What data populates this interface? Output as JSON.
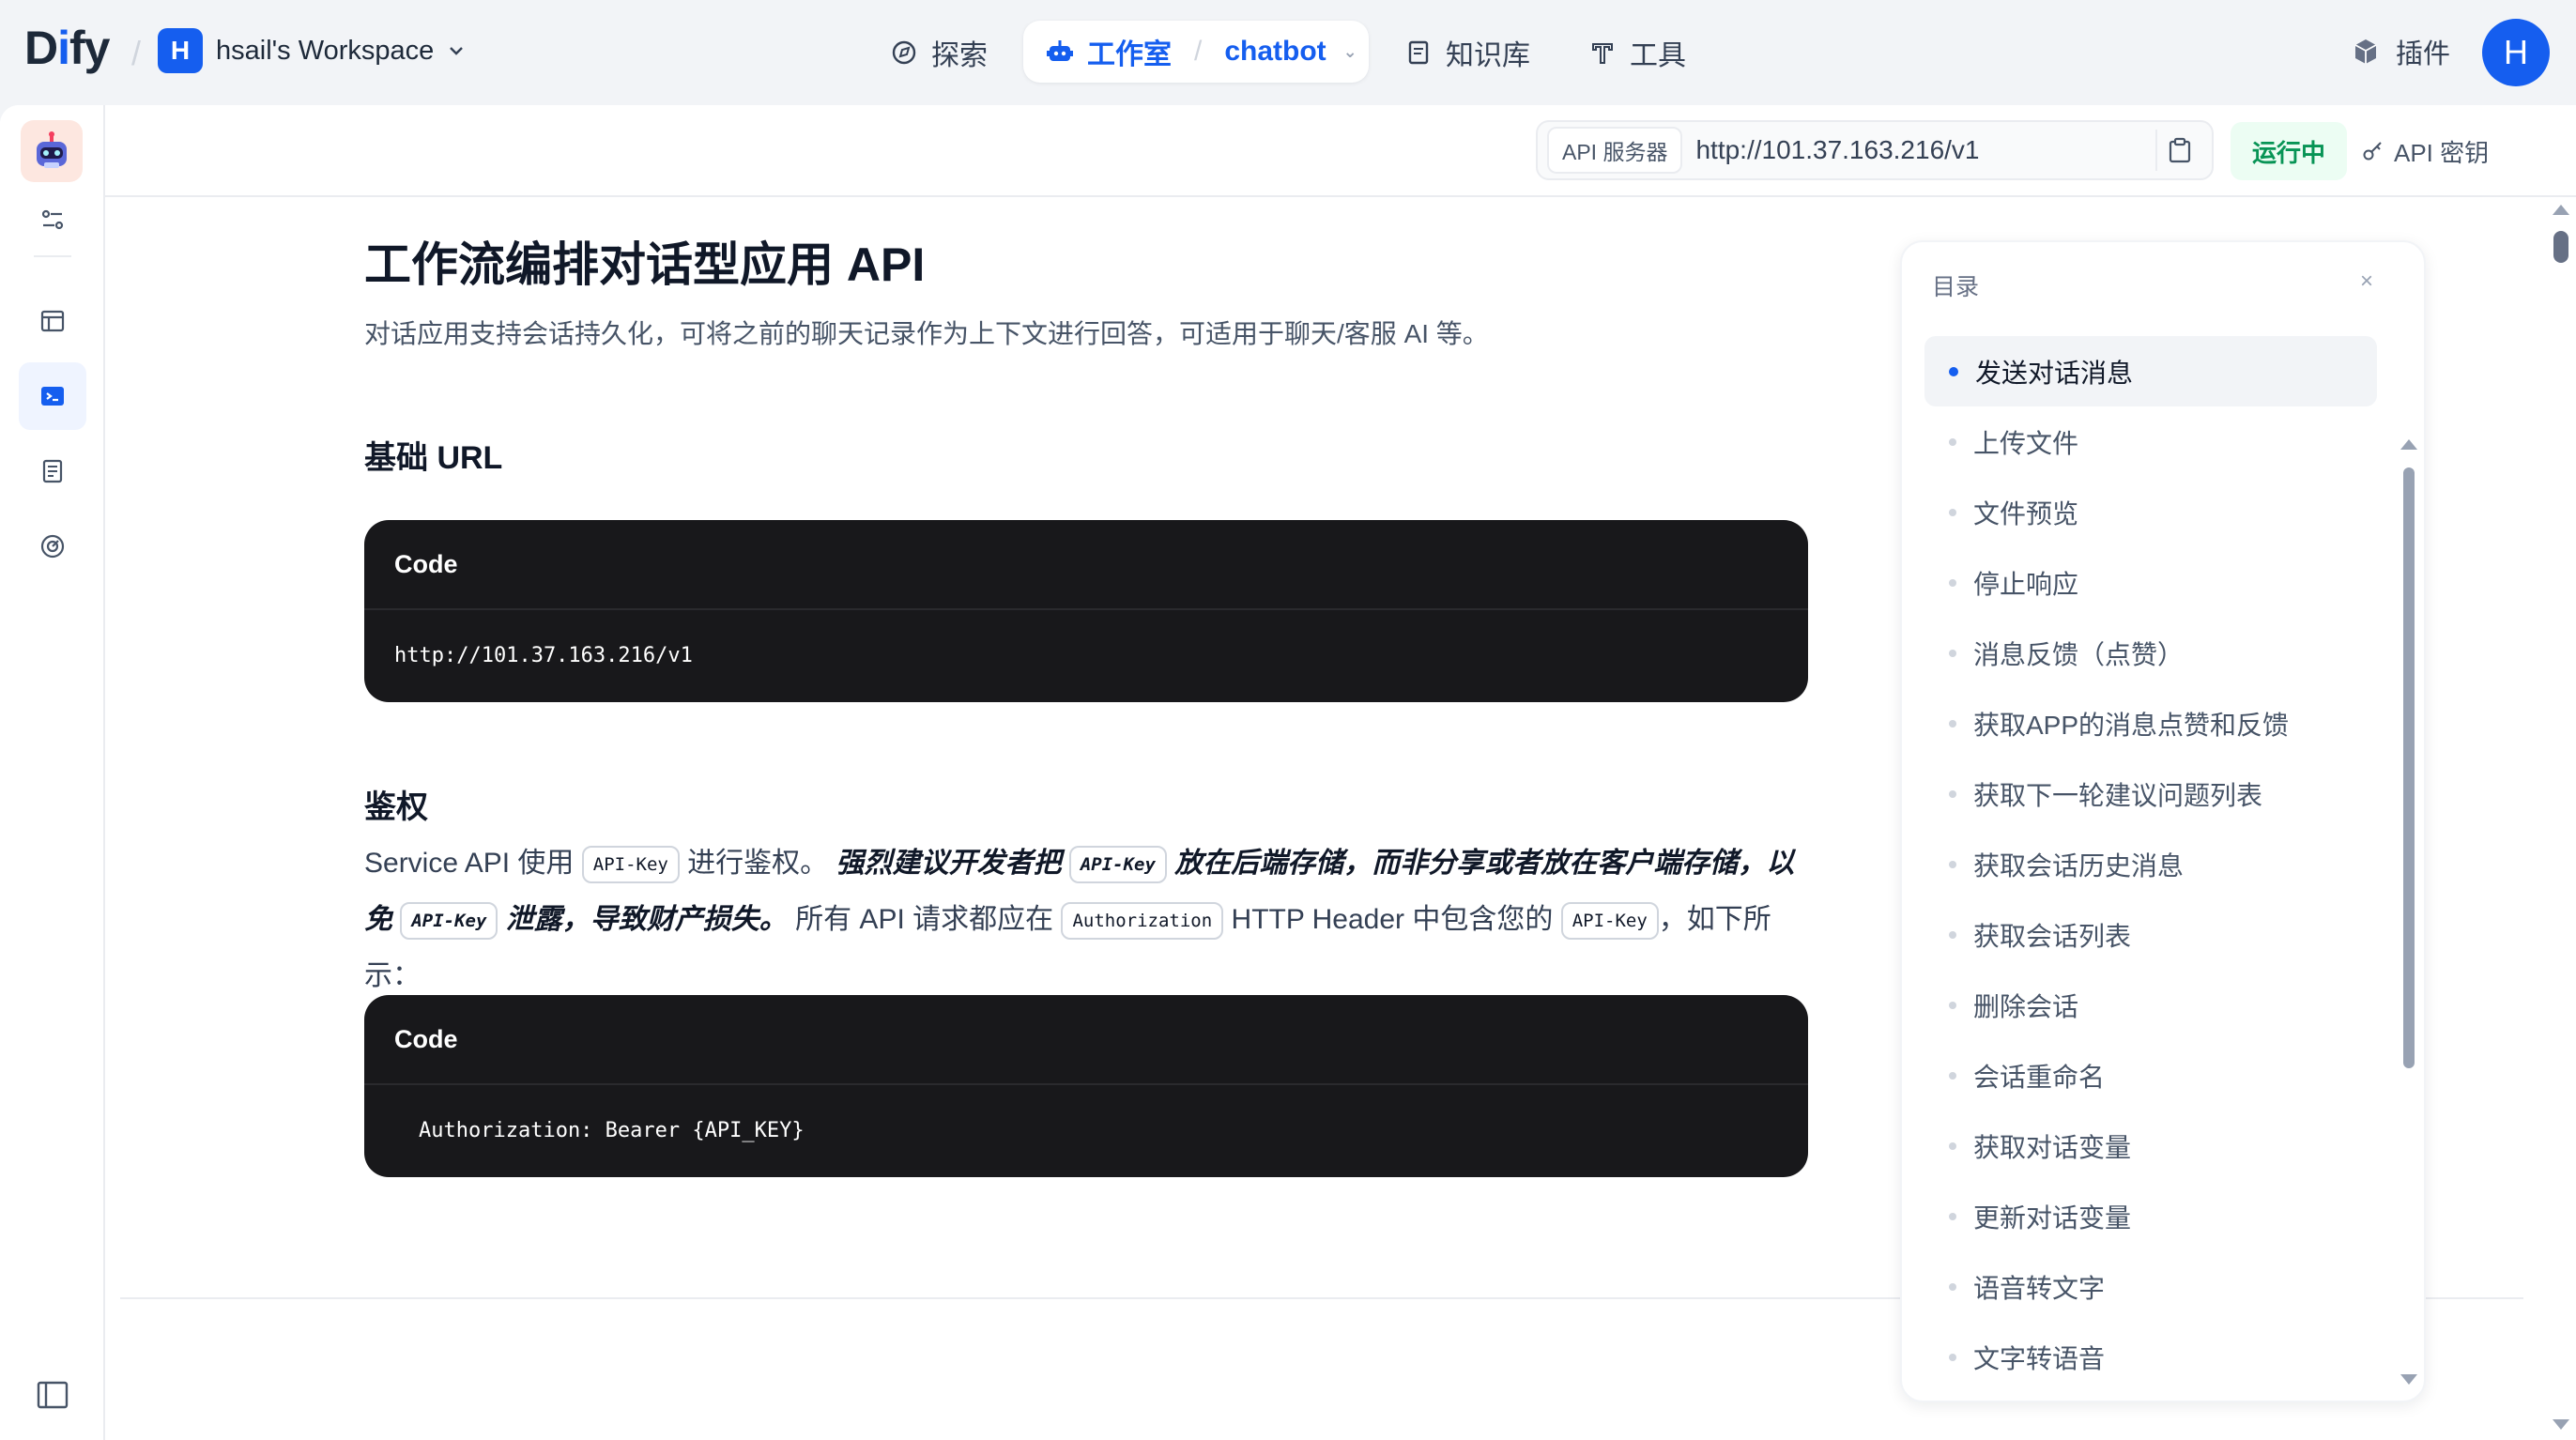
{
  "topbar": {
    "logo_prefix": "D",
    "logo_i": "i",
    "logo_suffix": "fy",
    "workspace_initial": "H",
    "workspace_name": "hsail's Workspace",
    "nav": {
      "explore": "探索",
      "studio": "工作室",
      "app_name": "chatbot",
      "knowledge": "知识库",
      "tools": "工具"
    },
    "plugins": "插件",
    "user_initial": "H"
  },
  "apibar": {
    "server_tag": "API 服务器",
    "server_url": "http://101.37.163.216/v1",
    "status": "运行中",
    "api_key": "API 密钥"
  },
  "doc": {
    "title": "工作流编排对话型应用 API",
    "description": "对话应用支持会话持久化，可将之前的聊天记录作为上下文进行回答，可适用于聊天/客服 AI 等。",
    "base_url_heading": "基础 URL",
    "code1_label": "Code",
    "code1_body": "http://101.37.163.216/v1",
    "auth_heading": "鉴权",
    "auth_p1": "Service API 使用 ",
    "auth_kbd1": "API-Key",
    "auth_p2": " 进行鉴权。 ",
    "auth_b1": "强烈建议开发者把 ",
    "auth_kbd2": "API-Key",
    "auth_b2": " 放在后端存储，而非分享或者放在客户端存储，以免 ",
    "auth_kbd3": "API-Key",
    "auth_b3": " 泄露，导致财产损失。",
    "auth_p3": " 所有 API 请求都应在 ",
    "auth_kbd4": "Authorization",
    "auth_p4": " HTTP Header 中包含您的 ",
    "auth_kbd5": "API-Key",
    "auth_p5": "，如下所示：",
    "code2_label": "Code",
    "code2_body": "Authorization: Bearer {API_KEY}"
  },
  "toc": {
    "title": "目录",
    "close": "×",
    "items": [
      "发送对话消息",
      "上传文件",
      "文件预览",
      "停止响应",
      "消息反馈（点赞）",
      "获取APP的消息点赞和反馈",
      "获取下一轮建议问题列表",
      "获取会话历史消息",
      "获取会话列表",
      "删除会话",
      "会话重命名",
      "获取对话变量",
      "更新对话变量",
      "语音转文字",
      "文字转语音"
    ]
  },
  "colors": {
    "accent": "#155eef",
    "running_bg": "#ecfdf3",
    "running_text": "#079455",
    "code_bg": "#18181b"
  }
}
